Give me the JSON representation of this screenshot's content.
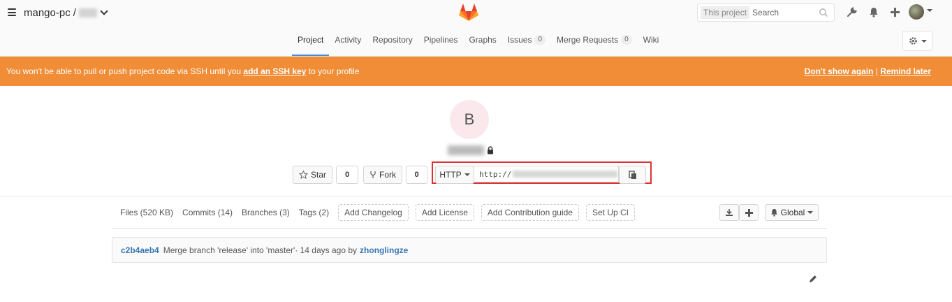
{
  "header": {
    "breadcrumb_group": "mango-pc",
    "breadcrumb_sep": "/",
    "search": {
      "scope": "This project",
      "placeholder": "Search"
    }
  },
  "nav": {
    "tabs": [
      {
        "label": "Project"
      },
      {
        "label": "Activity"
      },
      {
        "label": "Repository"
      },
      {
        "label": "Pipelines"
      },
      {
        "label": "Graphs"
      },
      {
        "label": "Issues",
        "badge": "0"
      },
      {
        "label": "Merge Requests",
        "badge": "0"
      },
      {
        "label": "Wiki"
      }
    ],
    "active": "Project"
  },
  "banner": {
    "msg_prefix": "You won't be able to pull or push project code via SSH until you ",
    "msg_link": "add an SSH key",
    "msg_suffix": " to your profile",
    "dont_show": "Don't show again",
    "sep": "|",
    "remind": "Remind later",
    "color": "#f08d36"
  },
  "project": {
    "avatar_letter": "B",
    "star_label": "Star",
    "star_count": "0",
    "fork_label": "Fork",
    "fork_count": "0",
    "clone_protocol": "HTTP",
    "clone_url_prefix": "http://"
  },
  "stats": {
    "files": "Files (520 KB)",
    "commits": "Commits (14)",
    "branches": "Branches (3)",
    "tags": "Tags (2)",
    "add_changelog": "Add Changelog",
    "add_license": "Add License",
    "add_contribution": "Add Contribution guide",
    "setup_ci": "Set Up CI",
    "notification": "Global"
  },
  "commit": {
    "sha": "c2b4aeb4",
    "message": "Merge branch 'release' into 'master'",
    "meta": " · 14 days ago by",
    "author": "zhonglingze"
  },
  "colors": {
    "link": "#3777b0",
    "active_tab": "#4a8bd3",
    "highlight": "#e03131"
  }
}
